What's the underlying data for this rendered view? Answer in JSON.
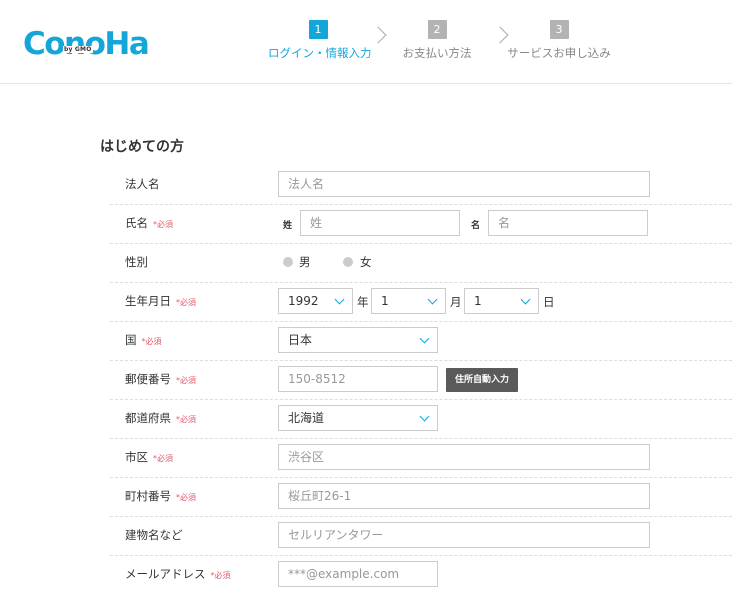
{
  "header": {
    "logo_text": "ConoHa",
    "logo_sub": "by GMO",
    "brand_color": "#15a6d9",
    "steps": [
      {
        "num": "1",
        "label": "ログイン・情報入力",
        "active": true
      },
      {
        "num": "2",
        "label": "お支払い方法",
        "active": false
      },
      {
        "num": "3",
        "label": "サービスお申し込み",
        "active": false
      }
    ]
  },
  "form": {
    "title": "はじめての方",
    "required_mark": "*必須",
    "corporate_name": {
      "label": "法人名",
      "placeholder": "法人名"
    },
    "name": {
      "label": "氏名",
      "last_prefix": "姓",
      "last_placeholder": "姓",
      "first_prefix": "名",
      "first_placeholder": "名"
    },
    "gender": {
      "label": "性別",
      "options": [
        "男",
        "女"
      ]
    },
    "birthday": {
      "label": "生年月日",
      "year": "1992",
      "year_unit": "年",
      "month": "1",
      "month_unit": "月",
      "day": "1",
      "day_unit": "日"
    },
    "country": {
      "label": "国",
      "value": "日本"
    },
    "postal": {
      "label": "郵便番号",
      "placeholder": "150-8512",
      "button": "住所自動入力"
    },
    "prefecture": {
      "label": "都道府県",
      "value": "北海道"
    },
    "city": {
      "label": "市区",
      "placeholder": "渋谷区"
    },
    "town": {
      "label": "町村番号",
      "placeholder": "桜丘町26-1"
    },
    "building": {
      "label": "建物名など",
      "placeholder": "セルリアンタワー"
    },
    "email": {
      "label": "メールアドレス",
      "placeholder": "***@example.com"
    }
  }
}
